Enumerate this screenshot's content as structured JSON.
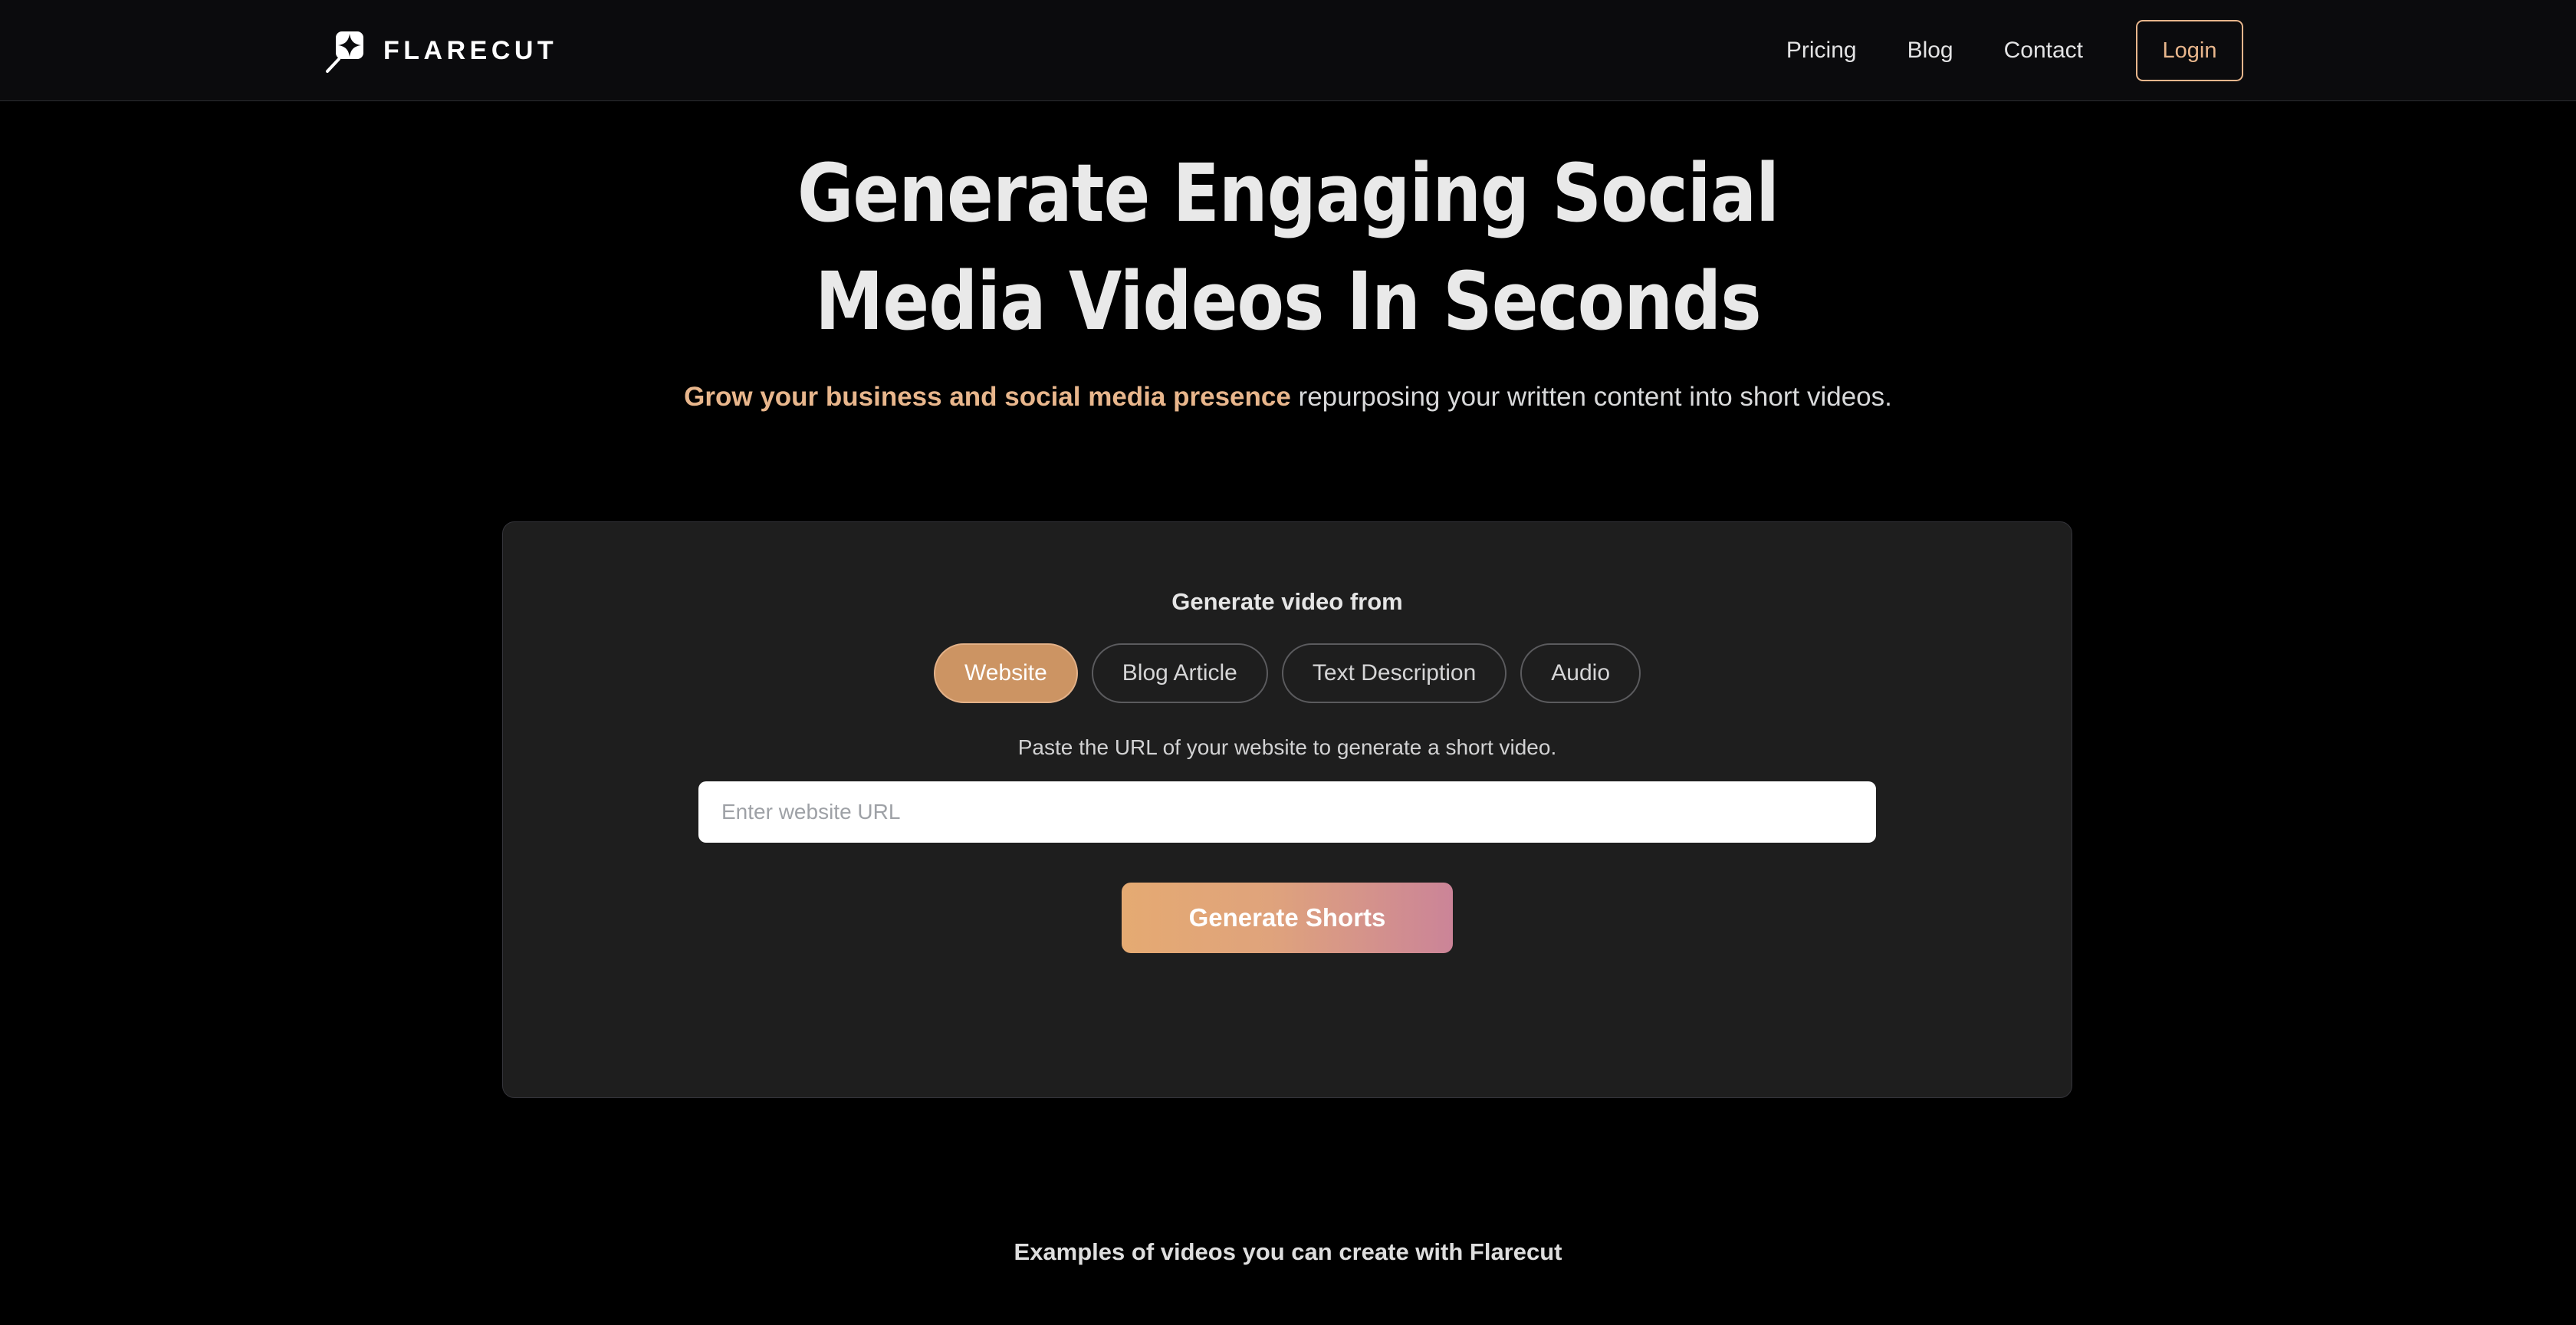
{
  "header": {
    "brand": {
      "name": "FLARECUT",
      "icon": "flare-logo-icon"
    },
    "nav_links": [
      {
        "label": "Pricing"
      },
      {
        "label": "Blog"
      },
      {
        "label": "Contact"
      }
    ],
    "login_label": "Login",
    "colors": {
      "accent": "#e8b68c",
      "background": "#0b0b0d",
      "border": "#2b2d31"
    }
  },
  "hero": {
    "headline_line1": "Generate Engaging Social",
    "headline_line2": "Media Videos In Seconds",
    "subhead_accent": "Grow your business and social media presence",
    "subhead_rest": " repurposing your written content into short videos."
  },
  "generator": {
    "title": "Generate video from",
    "tabs": [
      {
        "label": "Website",
        "active": true
      },
      {
        "label": "Blog Article",
        "active": false
      },
      {
        "label": "Text Description",
        "active": false
      },
      {
        "label": "Audio",
        "active": false
      }
    ],
    "hint": "Paste the URL of your website to generate a short video.",
    "url_input": {
      "value": "",
      "placeholder": "Enter website URL"
    },
    "cta_label": "Generate Shorts",
    "colors": {
      "card_background": "#1e1e1e",
      "active_tab": "#cc9463",
      "cta_gradient_start": "#e5aa72",
      "cta_gradient_end": "#cb8498"
    }
  },
  "examples": {
    "title": "Examples of videos you can create with Flarecut"
  }
}
